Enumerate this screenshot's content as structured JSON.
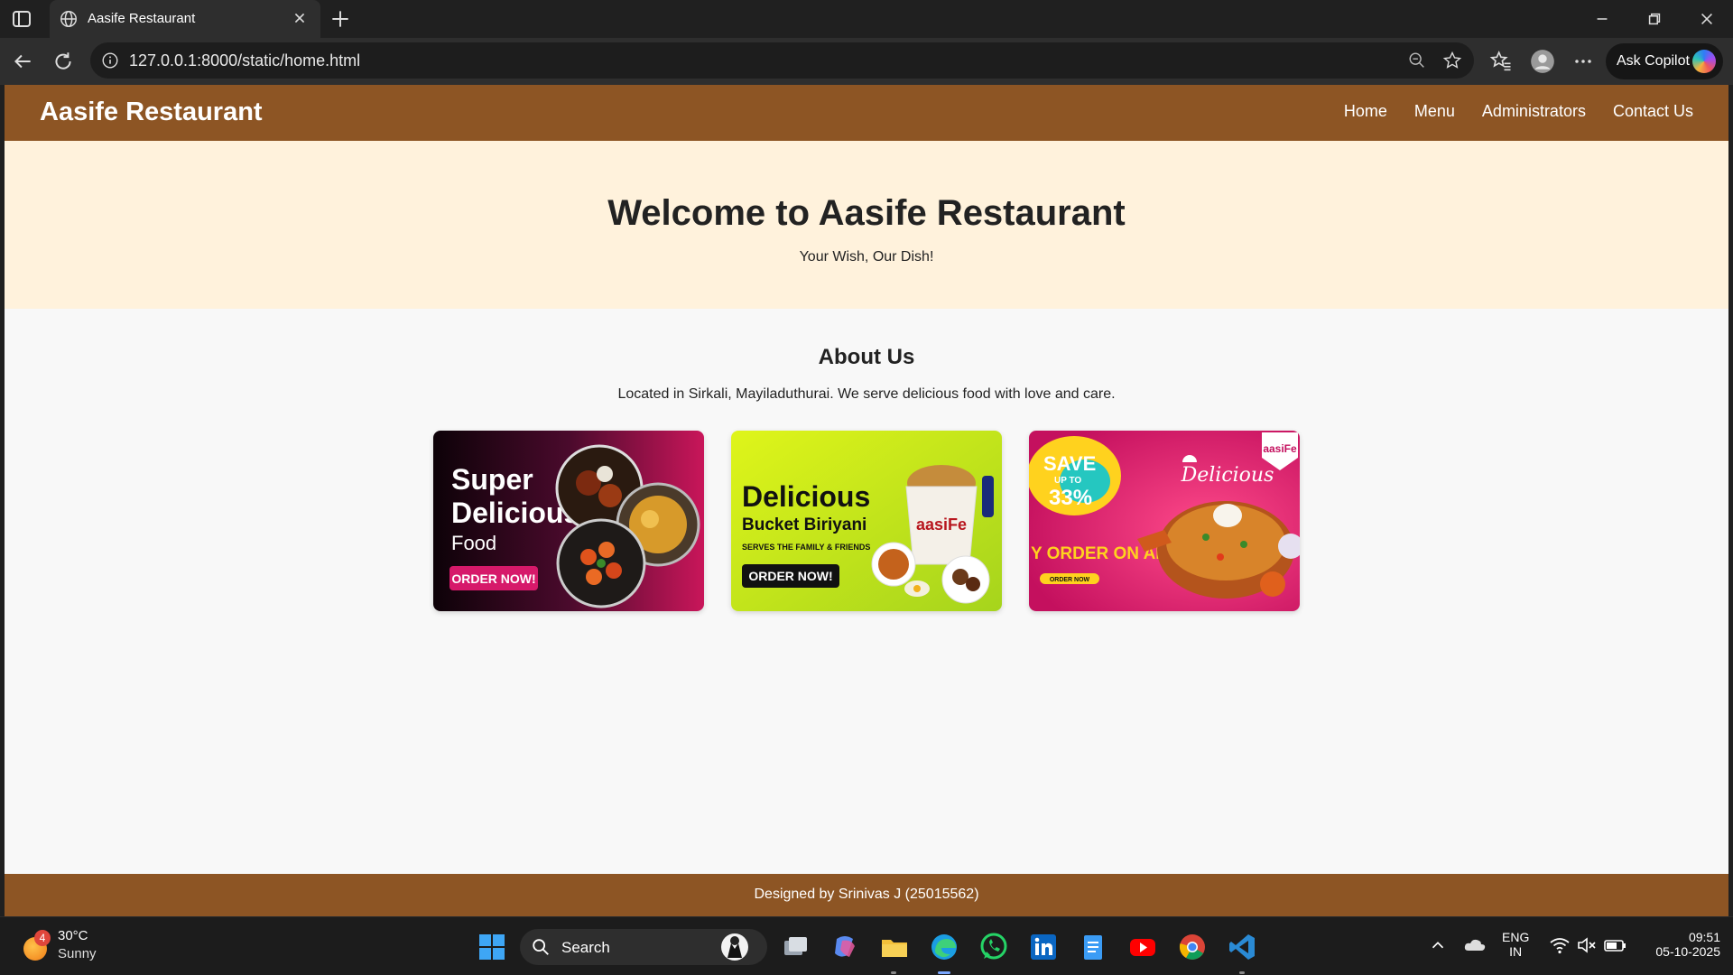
{
  "browser": {
    "tab_title": "Aasife Restaurant",
    "url": "127.0.0.1:8000/static/home.html",
    "copilot_label": "Ask Copilot"
  },
  "site": {
    "brand": "Aasife Restaurant",
    "nav": [
      "Home",
      "Menu",
      "Administrators",
      "Contact Us"
    ],
    "hero_title": "Welcome to Aasife Restaurant",
    "hero_subtitle": "Your Wish, Our Dish!",
    "about_title": "About Us",
    "about_text": "Located in Sirkali, Mayiladuthurai. We serve delicious food with love and care.",
    "footer": "Designed by Srinivas J (25015562)"
  },
  "cards": [
    {
      "line1": "Super",
      "line2": "Delicious",
      "line3": "Food",
      "button": "ORDER NOW!"
    },
    {
      "line1": "Delicious",
      "line2": "Bucket Biriyani",
      "line3": "SERVES THE FAMILY & FRIENDS",
      "button": "ORDER NOW!",
      "logo": "aasiFe"
    },
    {
      "save_line1": "SAVE",
      "save_line2": "UP TO",
      "save_line3": "33%",
      "promo": "Y ORDER ON APP",
      "button": "ORDER NOW",
      "script": "Delicious",
      "logo": "aasiFe"
    }
  ],
  "taskbar": {
    "weather_badge": "4",
    "temperature": "30°C",
    "condition": "Sunny",
    "search": "Search",
    "lang1": "ENG",
    "lang2": "IN",
    "time": "09:51",
    "date": "05-10-2025"
  },
  "colors": {
    "header": "#8d5524",
    "hero_bg": "#fff2dc",
    "page_bg": "#f8f8f8"
  }
}
